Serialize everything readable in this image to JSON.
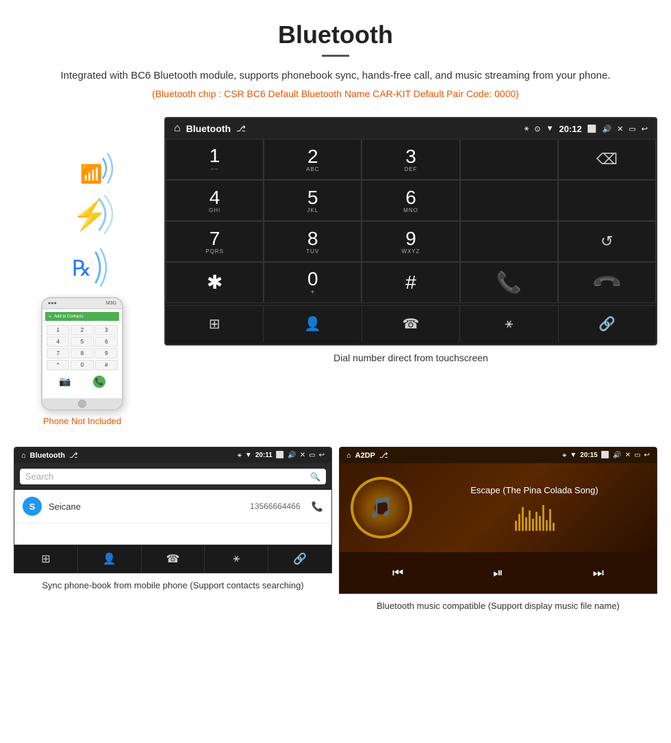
{
  "header": {
    "title": "Bluetooth",
    "description": "Integrated with BC6 Bluetooth module, supports phonebook sync, hands-free call, and music streaming from your phone.",
    "specs": "(Bluetooth chip : CSR BC6    Default Bluetooth Name CAR-KIT    Default Pair Code: 0000)"
  },
  "phone": {
    "label": "Phone Not Included",
    "menu_text": "Add to Contacts",
    "keys": [
      "1",
      "2",
      "3",
      "4",
      "5",
      "6",
      "7",
      "8",
      "9",
      "*",
      "0",
      "#"
    ]
  },
  "car_screen": {
    "status_title": "Bluetooth",
    "status_time": "20:12",
    "dialpad": [
      {
        "number": "1",
        "sub": "⌣⌣"
      },
      {
        "number": "2",
        "sub": "ABC"
      },
      {
        "number": "3",
        "sub": "DEF"
      },
      {
        "number": "",
        "sub": ""
      },
      {
        "number": "⌫",
        "sub": ""
      },
      {
        "number": "4",
        "sub": "GHI"
      },
      {
        "number": "5",
        "sub": "JKL"
      },
      {
        "number": "6",
        "sub": "MNO"
      },
      {
        "number": "",
        "sub": ""
      },
      {
        "number": "",
        "sub": ""
      },
      {
        "number": "7",
        "sub": "PQRS"
      },
      {
        "number": "8",
        "sub": "TUV"
      },
      {
        "number": "9",
        "sub": "WXYZ"
      },
      {
        "number": "",
        "sub": ""
      },
      {
        "number": "↺",
        "sub": ""
      },
      {
        "number": "✱",
        "sub": ""
      },
      {
        "number": "0",
        "sub": "+"
      },
      {
        "number": "#",
        "sub": ""
      },
      {
        "number": "📞",
        "sub": ""
      },
      {
        "number": "📞end",
        "sub": ""
      }
    ],
    "toolbar": [
      "⊞",
      "👤",
      "📞",
      "⚹",
      "🔗"
    ]
  },
  "screen_caption": "Dial number direct from touchscreen",
  "phonebook_panel": {
    "status_title": "Bluetooth",
    "status_time": "20:11",
    "search_placeholder": "Search",
    "contacts": [
      {
        "initial": "S",
        "name": "Seicane",
        "number": "13566664466"
      }
    ],
    "caption": "Sync phone-book from mobile phone\n(Support contacts searching)"
  },
  "music_panel": {
    "status_title": "A2DP",
    "status_time": "20:15",
    "song_title": "Escape (The Pina Colada Song)",
    "caption": "Bluetooth music compatible\n(Support display music file name)"
  }
}
